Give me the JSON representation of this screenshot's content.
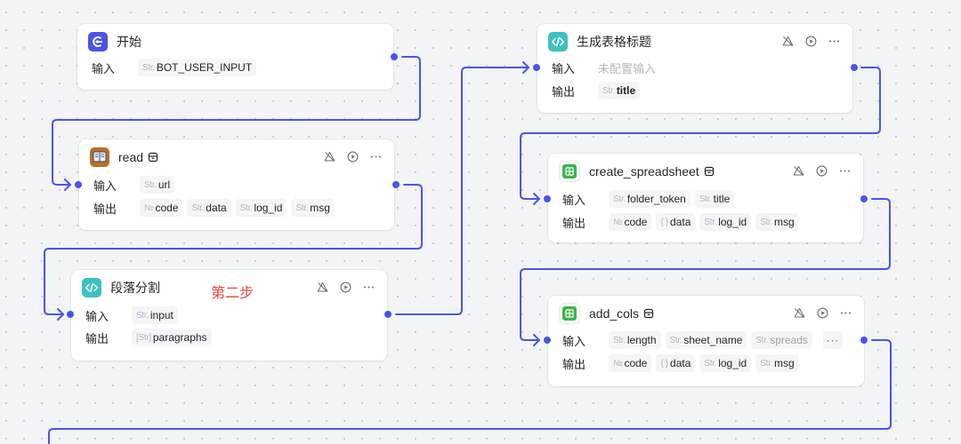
{
  "canvas": {
    "edge_color": "#4d53e8",
    "background": "#f3f4f6"
  },
  "nodes": {
    "start": {
      "title": "开始",
      "icon": "start-icon",
      "icon_color": "#4d53e8",
      "input_label": "输入",
      "inputs": [
        {
          "type": "Str.",
          "name": "BOT_USER_INPUT"
        }
      ]
    },
    "read": {
      "title": "read",
      "icon": "book-plugin-icon",
      "plugin_badge": "plugin-store-icon",
      "input_label": "输入",
      "output_label": "输出",
      "inputs": [
        {
          "type": "Str.",
          "name": "url"
        }
      ],
      "outputs": [
        {
          "type": "№",
          "name": "code"
        },
        {
          "type": "Str.",
          "name": "data"
        },
        {
          "type": "Str.",
          "name": "log_id"
        },
        {
          "type": "Str.",
          "name": "msg"
        }
      ],
      "actions": [
        "skip-icon",
        "run-icon",
        "more-icon"
      ]
    },
    "split": {
      "title": "段落分割",
      "annotation": "第二步",
      "annotation_color": "#e8433a",
      "icon": "code-icon",
      "icon_color": "#3ec1c1",
      "input_label": "输入",
      "output_label": "输出",
      "inputs": [
        {
          "type": "Str.",
          "name": "input"
        }
      ],
      "outputs": [
        {
          "type": "[Str]",
          "name": "paragraphs"
        }
      ],
      "actions": [
        "skip-icon",
        "run-icon",
        "more-icon"
      ]
    },
    "gen_title": {
      "title": "生成表格标题",
      "icon": "code-icon",
      "icon_color": "#3ec1c1",
      "input_label": "输入",
      "input_placeholder": "未配置输入",
      "output_label": "输出",
      "outputs": [
        {
          "type": "Str.",
          "name": "title"
        }
      ],
      "actions": [
        "skip-icon",
        "run-icon",
        "more-icon"
      ]
    },
    "create_sheet": {
      "title": "create_spreadsheet",
      "icon": "spreadsheet-icon",
      "icon_color": "#3bb54a",
      "plugin_badge": "plugin-store-icon",
      "input_label": "输入",
      "output_label": "输出",
      "inputs": [
        {
          "type": "Str.",
          "name": "folder_token"
        },
        {
          "type": "Str.",
          "name": "title"
        }
      ],
      "outputs": [
        {
          "type": "№",
          "name": "code"
        },
        {
          "type": "{ }",
          "name": "data"
        },
        {
          "type": "Str.",
          "name": "log_id"
        },
        {
          "type": "Str.",
          "name": "msg"
        }
      ],
      "actions": [
        "skip-icon",
        "run-icon",
        "more-icon"
      ]
    },
    "add_cols": {
      "title": "add_cols",
      "icon": "spreadsheet-icon",
      "icon_color": "#3bb54a",
      "plugin_badge": "plugin-store-icon",
      "input_label": "输入",
      "output_label": "输出",
      "inputs": [
        {
          "type": "Str.",
          "name": "length"
        },
        {
          "type": "Str.",
          "name": "sheet_name"
        },
        {
          "type": "Str.",
          "name": "spreads"
        }
      ],
      "inputs_more": "···",
      "outputs": [
        {
          "type": "№",
          "name": "code"
        },
        {
          "type": "{ }",
          "name": "data"
        },
        {
          "type": "Str.",
          "name": "log_id"
        },
        {
          "type": "Str.",
          "name": "msg"
        }
      ],
      "actions": [
        "skip-icon",
        "run-icon",
        "more-icon"
      ]
    }
  }
}
